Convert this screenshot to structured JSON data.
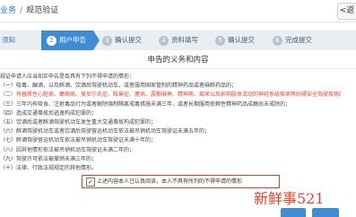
{
  "header": {
    "breadcrumb_link": "业务",
    "breadcrumb_current": "规范验证",
    "back_label": "<返"
  },
  "steps": [
    {
      "num": "1",
      "label": "须知"
    },
    {
      "num": "2",
      "label": "用户申告"
    },
    {
      "num": "3",
      "label": "确认提交"
    },
    {
      "num": "4",
      "label": "资料填写"
    },
    {
      "num": "5",
      "label": "确认提交"
    },
    {
      "num": "6",
      "label": "完成提交"
    }
  ],
  "panel": {
    "title": "申告的义务和内容",
    "lines": [
      "规证申请人应当如实申告是否具有下列不得申请的情形：",
      "（一）吸毒、酗酒，以及醉酒、饮酒后驾驶机动车，或者服用国家管制的精神药品或者麻醉药品的；",
      "（二）有器质性心脏病、癫痫病、美尼尔氏症、眩晕症、癔病、震颤麻痹、精神病、痴呆以及影响肢体活动的神经系统疾病等妨碍安全驾驶疾病的；",
      "（三）三年内有吸食、注射毒品行为或者解除强制隔离戒毒措施未满三年，或者长期服用依赖性精神药品成瘾尚未戒除的；",
      "（四）造成交通事故后逃逸构成犯罪的；",
      "（五）饮酒后或者醉酒驾驶机动车发生重大交通事故构成犯罪的；",
      "（六）醉酒驾驶机动车或者饮酒后驾驶营运机动车依法被吊销机动车驾驶证未满五年的；",
      "（七）醉酒驾驶营运机动车依法被吊销机动车驾驶证未满十年的；",
      "（八）因其他情形依法被吊销机动车驾驶证未满二年的；",
      "（九）驾驶许可依法被撤销未满三年的；",
      "（十）法律、行政法规规定的其他情形。"
    ],
    "red_line_index": 2,
    "agree_text": "上述内容本人已认真阅读，本人不具有所列的不得申请的情形"
  },
  "watermark": "新鲜事521",
  "colors": {
    "accent": "#3f8bd6",
    "alert": "#e0432f"
  }
}
